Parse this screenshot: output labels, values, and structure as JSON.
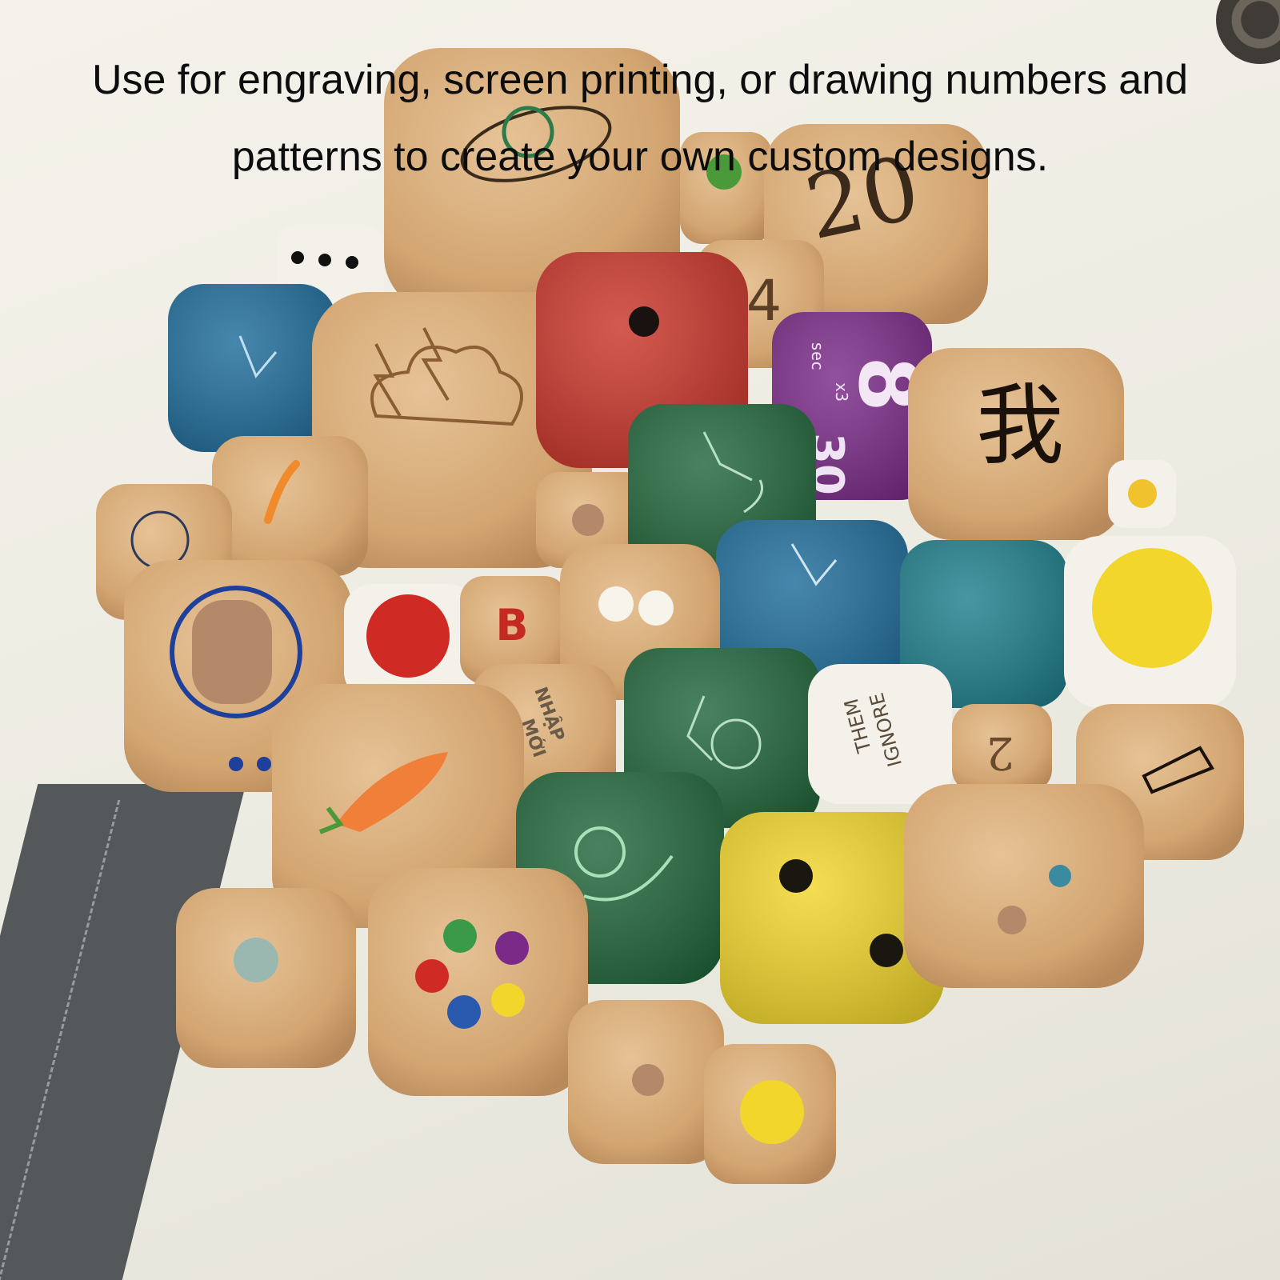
{
  "caption": {
    "line1": "Use for engraving, screen printing, or drawing numbers and",
    "line2": "patterns to create your own custom designs."
  },
  "dice_text": {
    "twenty": "20",
    "four": "4",
    "eight": "8",
    "sec": "sec",
    "x3": "x3",
    "wo": "我",
    "thirty": "30",
    "b": "B",
    "two": "2",
    "ignore": "IGNORE",
    "them": "THEM",
    "nhap": "NHẬP",
    "moi": "MỚI"
  },
  "colors": {
    "wood": "#d7ad7c",
    "red": "#c9352a",
    "blue": "#1f6c9a",
    "teal": "#1f7f8c",
    "green": "#22663b",
    "purple": "#7a2a87",
    "yellow": "#f2d62c",
    "white": "#f3f1ea"
  }
}
